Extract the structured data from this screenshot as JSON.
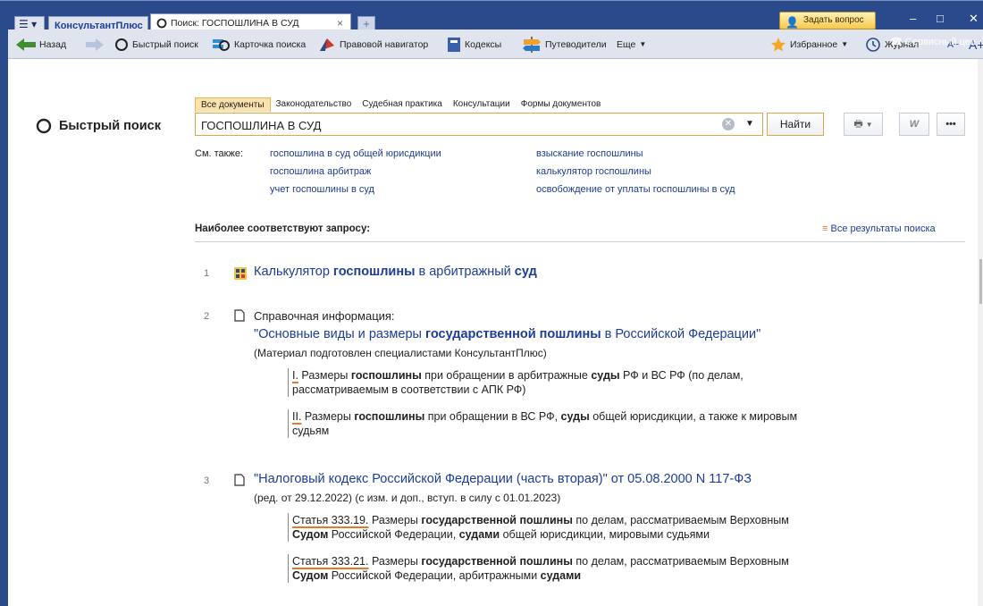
{
  "window": {
    "app_tab": "КонсультантПлюс",
    "doc_tab": "Поиск: ГОСПОШЛИНА В СУД",
    "ask_button": "Задать вопрос",
    "service_label": "Сервисный цен",
    "new_tab_symbol": "+",
    "close_symbol": "×"
  },
  "toolbar": {
    "back": "Назад",
    "quick_search": "Быстрый поиск",
    "search_card": "Карточка поиска",
    "legal_nav": "Правовой навигатор",
    "codes": "Кодексы",
    "guides": "Путеводители",
    "more": "Еще",
    "favorites": "Избранное",
    "journal": "Журнал",
    "font_small": "A−",
    "font_large": "A+"
  },
  "search": {
    "section_title": "Быстрый поиск",
    "tabs": [
      "Все документы",
      "Законодательство",
      "Судебная практика",
      "Консультации",
      "Формы документов"
    ],
    "query": "ГОСПОШЛИНА В СУД",
    "find_button": "Найти"
  },
  "see_also": {
    "label": "См. также:",
    "links": [
      "госпошлина в суд общей юрисдикции",
      "госпошлина арбитраж",
      "учет госпошлины в суд",
      "взыскание госпошлины",
      "калькулятор госпошлины",
      "освобождение от уплаты госпошлины в суд"
    ]
  },
  "results": {
    "heading": "Наиболее соответствуют запросу:",
    "all_results": "Все результаты поиска",
    "items": [
      {
        "num": "1",
        "title_a": "Калькулятор ",
        "title_b": "госпошлины",
        "title_c": " в арбитражный ",
        "title_d": "суд"
      },
      {
        "num": "2",
        "category": "Справочная информация:",
        "title_a": "\"Основные виды и размеры ",
        "title_b": "государственной пошлины",
        "title_c": " в Российской Федерации\"",
        "note": "(Материал подготовлен специалистами КонсультантПлюс)",
        "fragments": [
          {
            "lead": "I.",
            "t1": " Размеры ",
            "b1": "госпошлины",
            "t2": " при обращении в арбитражные ",
            "b2": "суды",
            "t3": " РФ и ВС РФ (по делам,",
            "line2": "рассматриваемым в соответствии с АПК РФ)"
          },
          {
            "lead": "II.",
            "t1": " Размеры ",
            "b1": "госпошлины",
            "t2": " при обращении в ВС РФ, ",
            "b2": "суды",
            "t3": " общей юрисдикции, а также к мировым",
            "line2": "судьям"
          }
        ]
      },
      {
        "num": "3",
        "title": "\"Налоговый кодекс Российской Федерации (часть вторая)\" от 05.08.2000 N 117-ФЗ",
        "note": "(ред. от 29.12.2022) (с изм. и доп., вступ. в силу с 01.01.2023)",
        "fragments": [
          {
            "lead": "Статья 333.19.",
            "t1": " Размеры ",
            "b1": "государственной пошлины",
            "t2": " по делам, рассматриваемым Верховным",
            "l2b1": "Судом",
            "l2t1": " Российской Федерации, ",
            "l2b2": "судами",
            "l2t2": " общей юрисдикции, мировыми судьями"
          },
          {
            "lead": "Статья 333.21.",
            "t1": " Размеры ",
            "b1": "государственной пошлины",
            "t2": " по делам, рассматриваемым Верховным",
            "l2b1": "Судом",
            "l2t1": " Российской Федерации, арбитражными ",
            "l2b2": "судами",
            "l2t2": ""
          }
        ]
      }
    ]
  }
}
